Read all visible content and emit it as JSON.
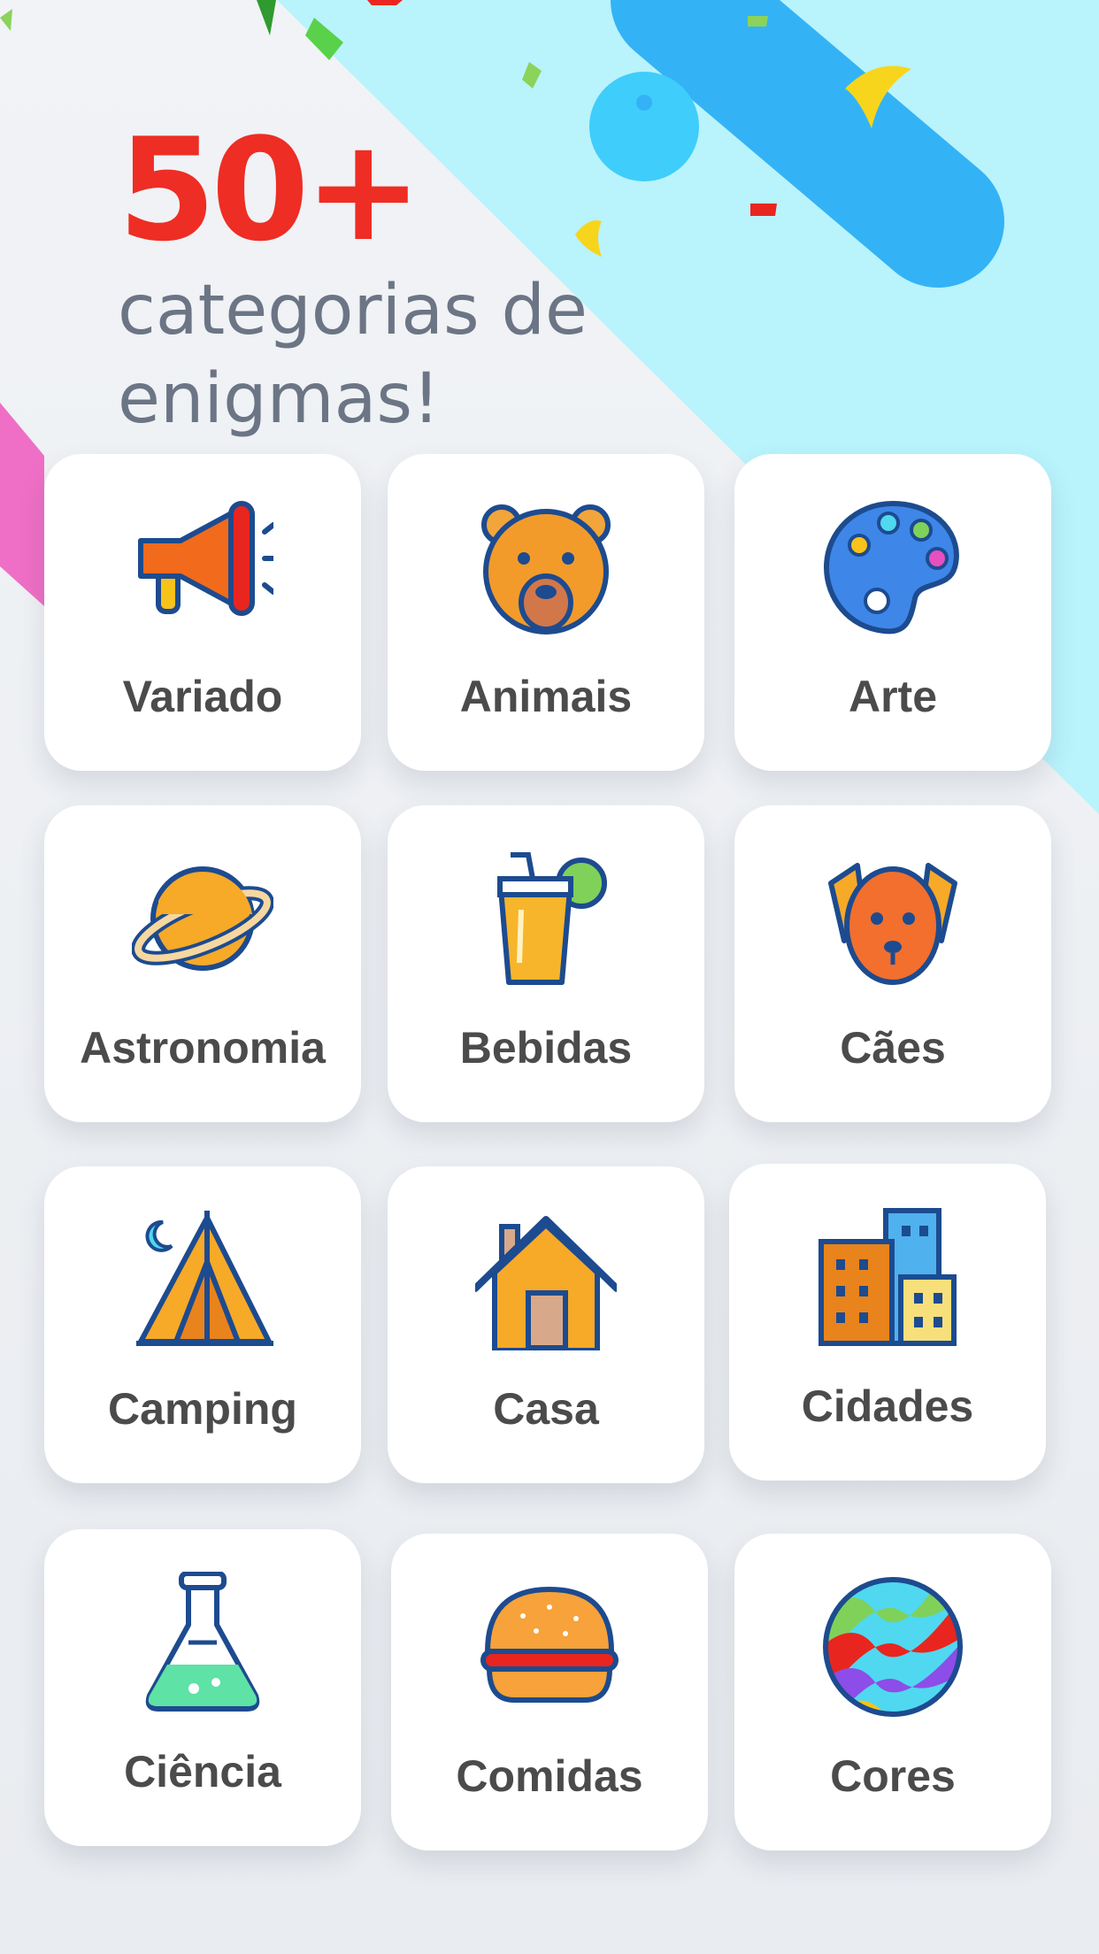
{
  "headline": {
    "number": "50+",
    "subtitle": "categorias de enigmas!"
  },
  "colors": {
    "accent_red": "#ee2d24",
    "subtitle_gray": "#6c7585",
    "stripe_light": "#b9f3fc",
    "stripe_blue": "#33b3f5",
    "icon_outline": "#1d4b8f"
  },
  "categories": [
    {
      "label": "Variado",
      "icon": "megaphone-icon"
    },
    {
      "label": "Animais",
      "icon": "bear-icon"
    },
    {
      "label": "Arte",
      "icon": "palette-icon"
    },
    {
      "label": "Astronomia",
      "icon": "planet-icon"
    },
    {
      "label": "Bebidas",
      "icon": "drink-icon"
    },
    {
      "label": "Cães",
      "icon": "dog-icon"
    },
    {
      "label": "Camping",
      "icon": "tent-icon"
    },
    {
      "label": "Casa",
      "icon": "house-icon"
    },
    {
      "label": "Cidades",
      "icon": "buildings-icon"
    },
    {
      "label": "Ciência",
      "icon": "flask-icon"
    },
    {
      "label": "Comidas",
      "icon": "burger-icon"
    },
    {
      "label": "Cores",
      "icon": "colorful-ball-icon"
    }
  ]
}
